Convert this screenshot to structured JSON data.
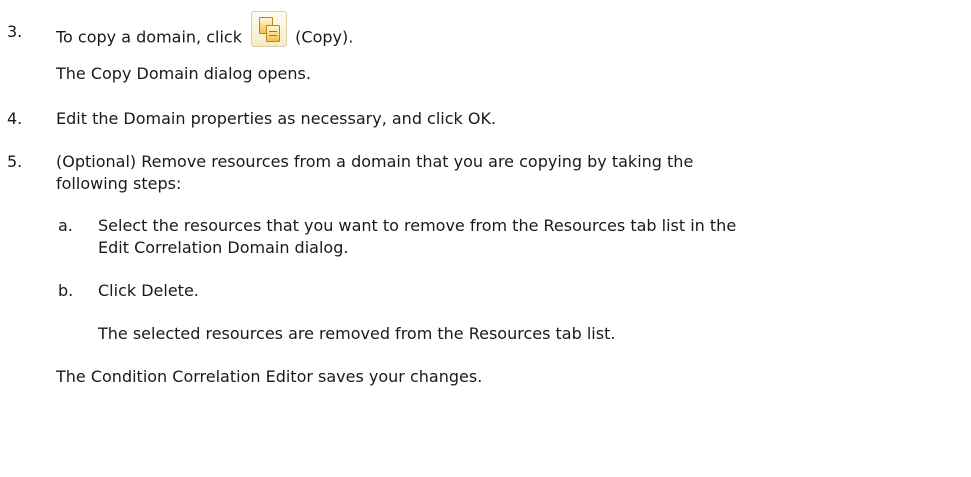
{
  "steps": {
    "step3": {
      "number": "3.",
      "text_before_icon": "To copy a domain, click",
      "text_after_icon": "(Copy).",
      "icon": "copy-icon",
      "result": "The Copy Domain dialog opens."
    },
    "step4": {
      "number": "4.",
      "text": "Edit the Domain properties as necessary, and click OK."
    },
    "step5": {
      "number": "5.",
      "text_line1": "(Optional) Remove resources from a domain that you are copying by taking the",
      "text_line2": "following steps:",
      "substeps": {
        "a": {
          "letter": "a.",
          "text_line1": "Select the resources that you want to remove from the Resources tab list in the",
          "text_line2": "Edit Correlation Domain dialog."
        },
        "b": {
          "letter": "b.",
          "text": "Click Delete.",
          "result": "The selected resources are removed from the Resources tab list."
        }
      }
    }
  },
  "conclusion": "The Condition Correlation Editor saves your changes."
}
